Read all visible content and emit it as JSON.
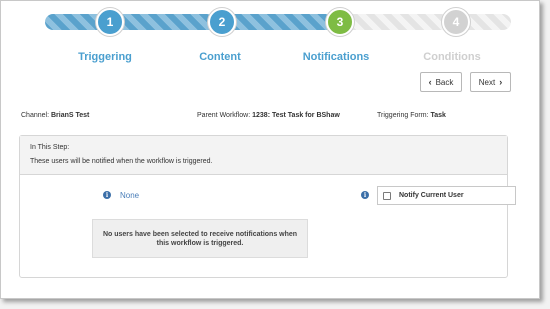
{
  "wizard": {
    "steps": [
      {
        "number": "1",
        "label": "Triggering",
        "state": "complete"
      },
      {
        "number": "2",
        "label": "Content",
        "state": "complete"
      },
      {
        "number": "3",
        "label": "Notifications",
        "state": "current"
      },
      {
        "number": "4",
        "label": "Conditions",
        "state": "disabled"
      }
    ],
    "back_label": "Back",
    "next_label": "Next"
  },
  "context": {
    "channel_label": "Channel:",
    "channel_value": "BrianS Test",
    "workflow_label": "Parent Workflow:",
    "workflow_value": "1238: Test Task for BShaw",
    "form_label": "Triggering Form:",
    "form_value": "Task"
  },
  "panel": {
    "title": "In This Step:",
    "description": "These users will be notified when the workflow is triggered.",
    "selected_users": "None",
    "notify_current_user_label": "Notify Current User",
    "notify_current_user_checked": false,
    "empty_message": "No users have been selected to receive notifications when this workflow is triggered."
  },
  "colors": {
    "step_complete": "#4a9fcf",
    "step_current": "#7ebc44",
    "step_disabled": "#d2d2d2",
    "link": "#4a7eb8"
  }
}
